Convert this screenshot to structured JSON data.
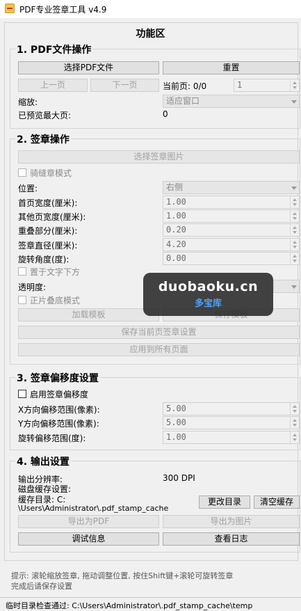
{
  "window": {
    "title": "PDF专业签章工具 v4.9"
  },
  "panel_title": "功能区",
  "sections": {
    "pdf_ops": {
      "title": "1. PDF文件操作",
      "select_pdf": "选择PDF文件",
      "reset": "重置",
      "prev_page": "上一页",
      "next_page": "下一页",
      "current_page_label": "当前页: 0/0",
      "page_spin_value": "1",
      "zoom_label": "缩放:",
      "zoom_value": "适应窗口",
      "max_preview_label": "已预览最大页:",
      "max_preview_value": "0"
    },
    "stamp_ops": {
      "title": "2. 签章操作",
      "select_image": "选择签章图片",
      "seam_mode": "骑缝章模式",
      "position_label": "位置:",
      "position_value": "右侧",
      "first_width_label": "首页宽度(厘米):",
      "first_width_value": "1.00",
      "other_width_label": "其他页宽度(厘米):",
      "other_width_value": "1.00",
      "overlap_label": "重叠部分(厘米):",
      "overlap_value": "0.20",
      "diameter_label": "签章直径(厘米):",
      "diameter_value": "4.20",
      "rotation_label": "旋转角度(度):",
      "rotation_value": "0.00",
      "below_text": "置于文字下方",
      "opacity_label": "透明度:",
      "front_overlay": "正片叠底模式",
      "load_template": "加载模板",
      "save_template": "保存模板",
      "save_current": "保存当前页签章设置",
      "apply_all": "应用到所有页面"
    },
    "offset": {
      "title": "3. 签章偏移度设置",
      "enable": "启用签章偏移度",
      "x_label": "X方向偏移范围(像素):",
      "x_value": "5.00",
      "y_label": "Y方向偏移范围(像素):",
      "y_value": "5.00",
      "rot_label": "旋转偏移范围(度):",
      "rot_value": "1.00"
    },
    "output": {
      "title": "4. 输出设置",
      "dpi_label": "输出分辨率:",
      "dpi_value": "300 DPI",
      "cache_setting": "磁盘缓存设置:",
      "cache_dir_label": "缓存目录: C:",
      "cache_dir_path": "\\Users\\Administrator\\.pdf_stamp_cache",
      "change_dir": "更改目录",
      "clear_cache": "清空缓存",
      "export_pdf": "导出为PDF",
      "export_image": "导出为图片",
      "debug_info": "调试信息",
      "view_log": "查看日志"
    }
  },
  "hint": {
    "line1": "提示: 滚轮缩放签章, 拖动调整位置, 按住Shift键+滚轮可旋转签章",
    "line2": "完成后请保存设置"
  },
  "status": "临时目录检查通过: C:\\Users\\Administrator\\.pdf_stamp_cache\\temp",
  "watermark": {
    "main": "duobaoku.cn",
    "sub": "多宝库"
  }
}
